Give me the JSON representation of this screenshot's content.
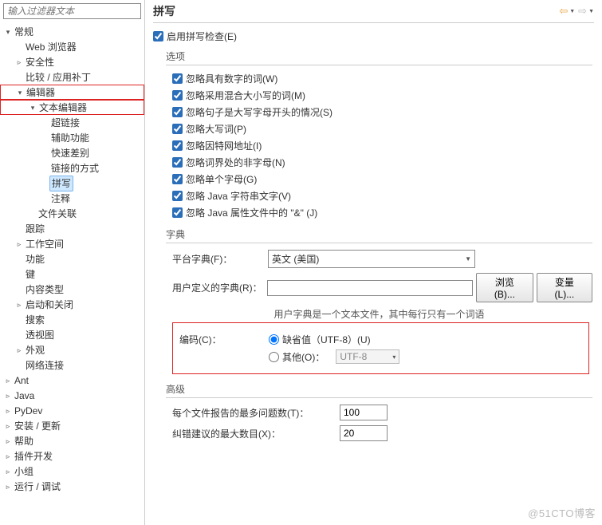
{
  "filter_placeholder": "输入过滤器文本",
  "page_title": "拼写",
  "enable_label": "启用拼写检查(E)",
  "tree": {
    "general": "常规",
    "web": "Web 浏览器",
    "security": "安全性",
    "compare": "比较 / 应用补丁",
    "editor": "编辑器",
    "text_editor": "文本编辑器",
    "hyperlink": "超链接",
    "aux": "辅助功能",
    "quickdiff": "快速差别",
    "linkmode": "链接的方式",
    "spelling": "拼写",
    "annotation": "注释",
    "fileassoc": "文件关联",
    "tracking": "跟踪",
    "workspace": "工作空间",
    "function": "功能",
    "keys": "键",
    "content": "内容类型",
    "startup": "启动和关闭",
    "search": "搜索",
    "perspective": "透视图",
    "appearance": "外观",
    "network": "网络连接",
    "ant": "Ant",
    "java": "Java",
    "pydev": "PyDev",
    "install": "安装 / 更新",
    "help": "帮助",
    "plugin": "插件开发",
    "team": "小组",
    "run": "运行 / 调试"
  },
  "options": {
    "title": "选项",
    "w": "忽略具有数字的词(W)",
    "m": "忽略采用混合大小写的词(M)",
    "s": "忽略句子是大写字母开头的情况(S)",
    "p": "忽略大写词(P)",
    "i": "忽略因特网地址(I)",
    "n": "忽略词界处的非字母(N)",
    "g": "忽略单个字母(G)",
    "v": "忽略 Java 字符串文字(V)",
    "j": "忽略 Java 属性文件中的 \"&\" (J)"
  },
  "dict": {
    "title": "字典",
    "platform_label": "平台字典(F)：",
    "platform_value": "英文 (美国)",
    "user_label": "用户定义的字典(R)：",
    "browse": "浏览(B)...",
    "var": "变量(L)...",
    "hint": "用户字典是一个文本文件，其中每行只有一个词语",
    "encoding_label": "编码(C)：",
    "default_radio": "缺省值（UTF-8）(U)",
    "other_radio": "其他(O)：",
    "other_value": "UTF-8"
  },
  "adv": {
    "title": "高级",
    "max_problems_label": "每个文件报告的最多问题数(T)：",
    "max_problems_value": "100",
    "max_suggest_label": "纠错建议的最大数目(X)：",
    "max_suggest_value": "20"
  },
  "watermark": "@51CTO博客"
}
